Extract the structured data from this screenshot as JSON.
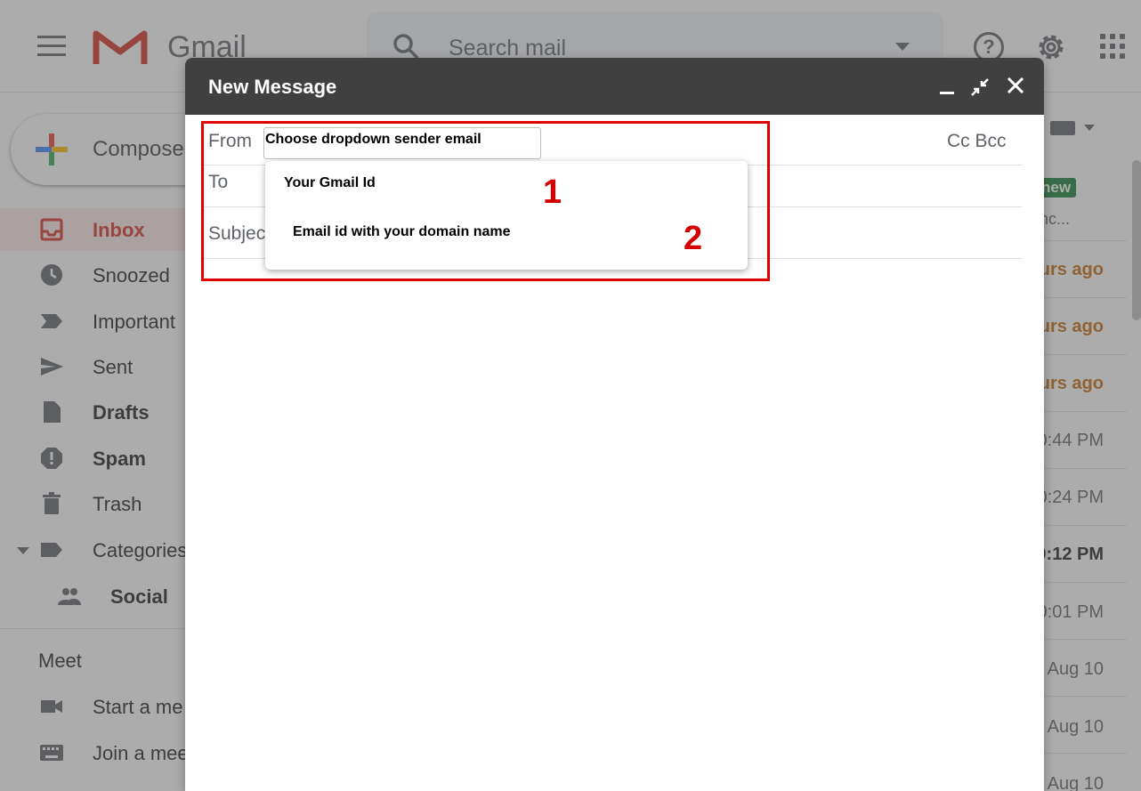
{
  "app": {
    "logo_text": "Gmail"
  },
  "search": {
    "placeholder": "Search mail"
  },
  "sidebar": {
    "compose_label": "Compose",
    "items": [
      {
        "label": "Inbox",
        "icon": "inbox-icon"
      },
      {
        "label": "Snoozed",
        "icon": "clock-icon"
      },
      {
        "label": "Important",
        "icon": "important-icon"
      },
      {
        "label": "Sent",
        "icon": "send-icon"
      },
      {
        "label": "Drafts",
        "icon": "draft-icon"
      },
      {
        "label": "Spam",
        "icon": "spam-icon"
      },
      {
        "label": "Trash",
        "icon": "trash-icon"
      },
      {
        "label": "Categories",
        "icon": "label-icon"
      },
      {
        "label": "Social",
        "icon": "people-icon"
      }
    ],
    "meet": {
      "title": "Meet",
      "items": [
        {
          "label": "Start a me",
          "icon": "video-icon"
        },
        {
          "label": "Join a mee",
          "icon": "keyboard-icon"
        }
      ]
    }
  },
  "inbox": {
    "new_badge": "new",
    "snippet": "nc...",
    "times": [
      "urs ago",
      "urs ago",
      "urs ago",
      "0:44 PM",
      "0:24 PM",
      "0:12 PM",
      "0:01 PM",
      "Aug 10",
      "Aug 10",
      "Aug 10"
    ]
  },
  "compose": {
    "title": "New Message",
    "from_label": "From",
    "to_label": "To",
    "subject_label": "Subjec",
    "cc_bcc": "Cc Bcc",
    "from_value": "Choose dropdown sender email",
    "options": [
      {
        "label": "Your Gmail Id",
        "marker": "1"
      },
      {
        "label": "Email id with your domain name",
        "marker": "2"
      }
    ]
  },
  "colors": {
    "accent_red": "#d93025",
    "annotation_red": "#e00000",
    "header_dark": "#404040",
    "time_orange": "#c5690f",
    "badge_green": "#188038"
  }
}
